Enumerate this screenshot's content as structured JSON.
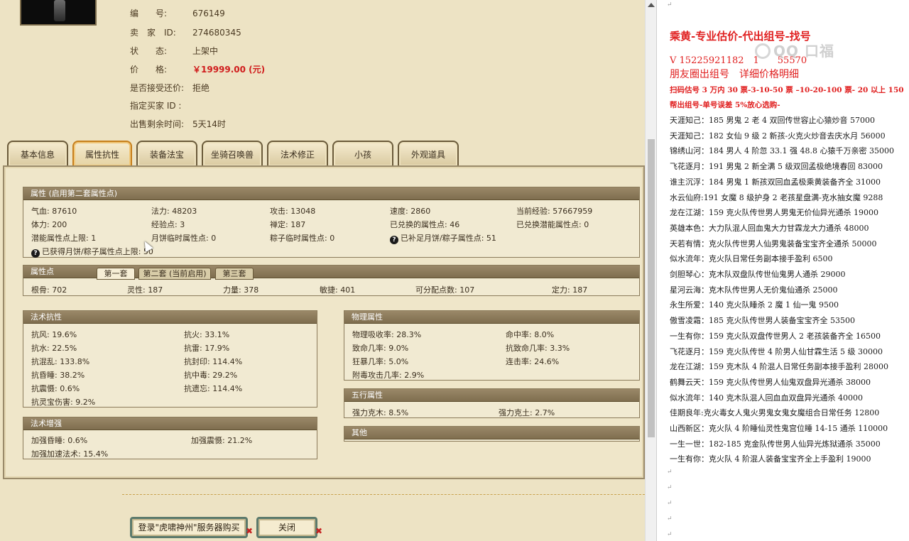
{
  "seller_info": {
    "rows": [
      {
        "label": "编　　号:",
        "value": "676149"
      },
      {
        "label": "卖　家　ID:",
        "value": "274680345"
      },
      {
        "label": "状　　态:",
        "value": "上架中"
      },
      {
        "label": "价　　格:",
        "value": "￥19999.00 (元)"
      },
      {
        "label": "是否接受还价:",
        "value": "拒绝"
      },
      {
        "label": "指定买家 ID :",
        "value": ""
      },
      {
        "label": "出售剩余时间:",
        "value": "5天14时"
      }
    ]
  },
  "tabs": [
    "基本信息",
    "属性抗性",
    "装备法宝",
    "坐骑召唤兽",
    "法术修正",
    "小孩",
    "外观道具"
  ],
  "attributes": {
    "title": "属性 (启用第二套属性点)",
    "cells": [
      "气血: 87610",
      "法力: 48203",
      "攻击: 13048",
      "速度: 2860",
      "当前经验: 57667959",
      "体力: 200",
      "经验点: 3",
      "禅定: 187",
      "已兑换的属性点: 46",
      "已兑换潜能属性点: 0",
      "潜能属性点上限: 1",
      "月饼临时属性点: 0",
      "粽子临时属性点: 0",
      "已补足月饼/粽子属性点: 51",
      "已获得月饼/粽子属性点上限: 50"
    ]
  },
  "points": {
    "title": "属性点",
    "subtabs": [
      "第一套",
      "第二套 (当前启用)",
      "第三套"
    ],
    "cells": [
      "根骨: 702",
      "灵性: 187",
      "力量: 378",
      "敏捷: 401",
      "可分配点数: 107",
      "定力: 187"
    ]
  },
  "resist": {
    "title": "法术抗性",
    "cells": [
      "抗风: 19.6%",
      "抗火: 33.1%",
      "抗水: 22.5%",
      "抗雷: 17.9%",
      "抗混乱: 133.8%",
      "抗封印: 114.4%",
      "抗昏睡: 38.2%",
      "抗中毒: 29.2%",
      "抗震慑: 0.6%",
      "抗遗忘: 114.4%",
      "抗灵宝伤害: 9.2%"
    ]
  },
  "physical": {
    "title": "物理属性",
    "cells": [
      "物理吸收率: 28.3%",
      "命中率: 8.0%",
      "致命几率: 9.0%",
      "抗致命几率: 3.3%",
      "狂暴几率: 5.0%",
      "连击率: 24.6%",
      "附毒攻击几率: 2.9%"
    ]
  },
  "enhance": {
    "title": "法术增强",
    "cells": [
      "加强昏睡: 0.6%",
      "加强震慑: 21.2%",
      "加强加速法术: 15.4%"
    ]
  },
  "wuxing": {
    "title": "五行属性",
    "cells": [
      "强力克木: 8.5%",
      "强力克土: 2.7%"
    ]
  },
  "other": {
    "title": "其他"
  },
  "buttons": {
    "buy": "登录\"虎啸神州\"服务器购买",
    "close": "关闭"
  },
  "doc": {
    "watermark": "QQ 口福",
    "header1": "乘黄-专业估价-代出组号-找号",
    "header2": "V 15225921182　1　　55570",
    "header3": "朋友圈出组号　详细价格明细",
    "red1": "扫码估号 3 万内 30 票-3-10-50 票 –10-20-100 票- 20 以上 150",
    "red2": "帮出组号-单号误差 5%放心选购-",
    "lines": [
      "天涯知己：185 男鬼 2 老 4 双回传世容止心猿炒音 57000",
      "天涯知己：182 女仙 9 级 2 新孩-火克火炒音去庆水月 56000",
      "锦绣山河：184 男人 4 阶忽 33.1 强 48.8 心猿千万亲密 35000",
      "飞花逐月：191 男鬼 2 新全满 5 级双回孟极绝境春回 83000",
      "谁主沉浮：184 男鬼 1 新孩双回血孟极乘黄装备齐全 31000",
      "水云仙府:191 女魔 8 级护身 2 老孩星盘满-克水抽女魔 9288",
      "龙在江湖：159 克火队传世男人男鬼无价仙异光通杀 19000",
      "英雄本色：大力队混人回血鬼大力甘霖龙大力通杀 48000",
      "天若有情：克火队传世男人仙男鬼装备宝宝齐全通杀 50000",
      "似水流年：克火队日常任务副本接手盈利 6500",
      "剑胆琴心：克木队双盘队传世仙鬼男人通杀 29000",
      "星河云海：克木队传世男人无价鬼仙通杀 25000",
      "永生所爱：140 克火队睡杀 2 魔 1 仙一鬼 9500",
      "傲雪凌霜：185 克火队传世男人装备宝宝齐全 53500",
      "一生有你：159 克火队双盘传世男人 2 老孩装备齐全 16500",
      "飞花逐月：159 克火队传世 4 阶男人仙甘霖生活 5 级 30000",
      "龙在江湖：159 克木队 4 阶混人日常任务副本接手盈利 28000",
      "鹤舞云天：159 克火队传世男人仙鬼双盘异光通杀 38000",
      "似水流年：140 克木队混人回血血双盘异光通杀 40000",
      "佳期良年:克火毒女人鬼火男鬼女鬼女魔组合日常任务 12800",
      "山西新区：克火队 4 阶睡仙灵性鬼宫位睡 14-15 通杀 110000",
      "一生一世：182-185 克金队传世男人仙异光炼狱通杀 35000",
      "一生有你：克火队 4 阶混人装备宝宝齐全上手盈利 19000"
    ]
  }
}
